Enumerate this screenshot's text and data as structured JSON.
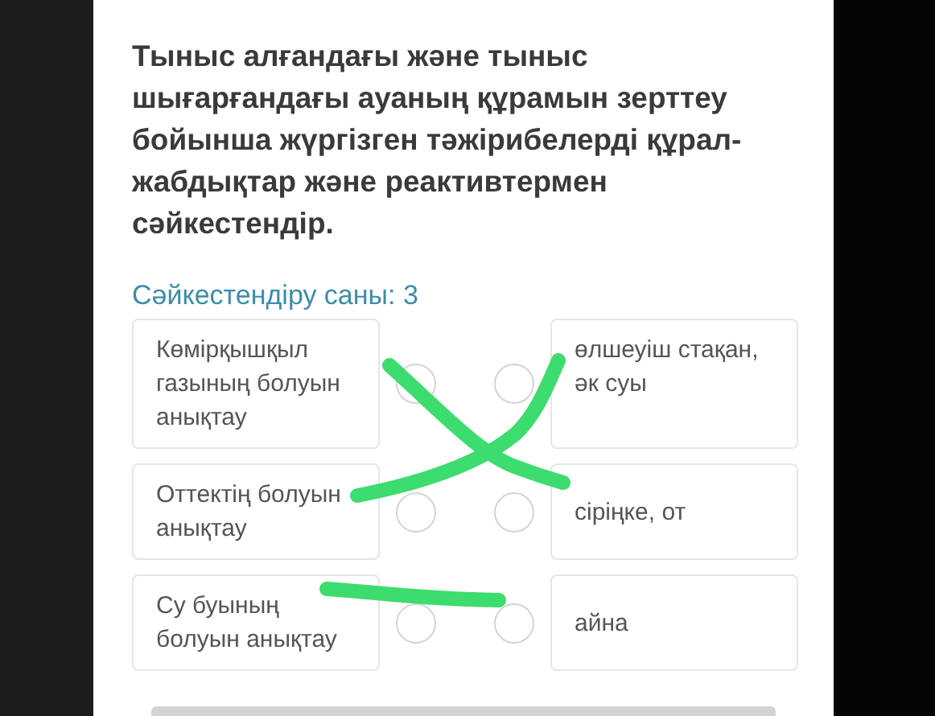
{
  "question": "Тыныс алғандағы және тыныс шығарғандағы ауаның құрамын зерттеу бойынша жүргізген тәжірибелерді құрал-жабдықтар және реактивтермен сәйкестендір.",
  "match_count": "Сәйкестендіру саны: 3",
  "rows": [
    {
      "left": "Көмірқышқыл газының болуын анықтау",
      "right": "өлшеуіш стақан, әк суы"
    },
    {
      "left": "Оттектің болуын анықтау",
      "right": "сіріңке, от"
    },
    {
      "left": "Су буының болуын анықтау",
      "right": "айна"
    }
  ]
}
